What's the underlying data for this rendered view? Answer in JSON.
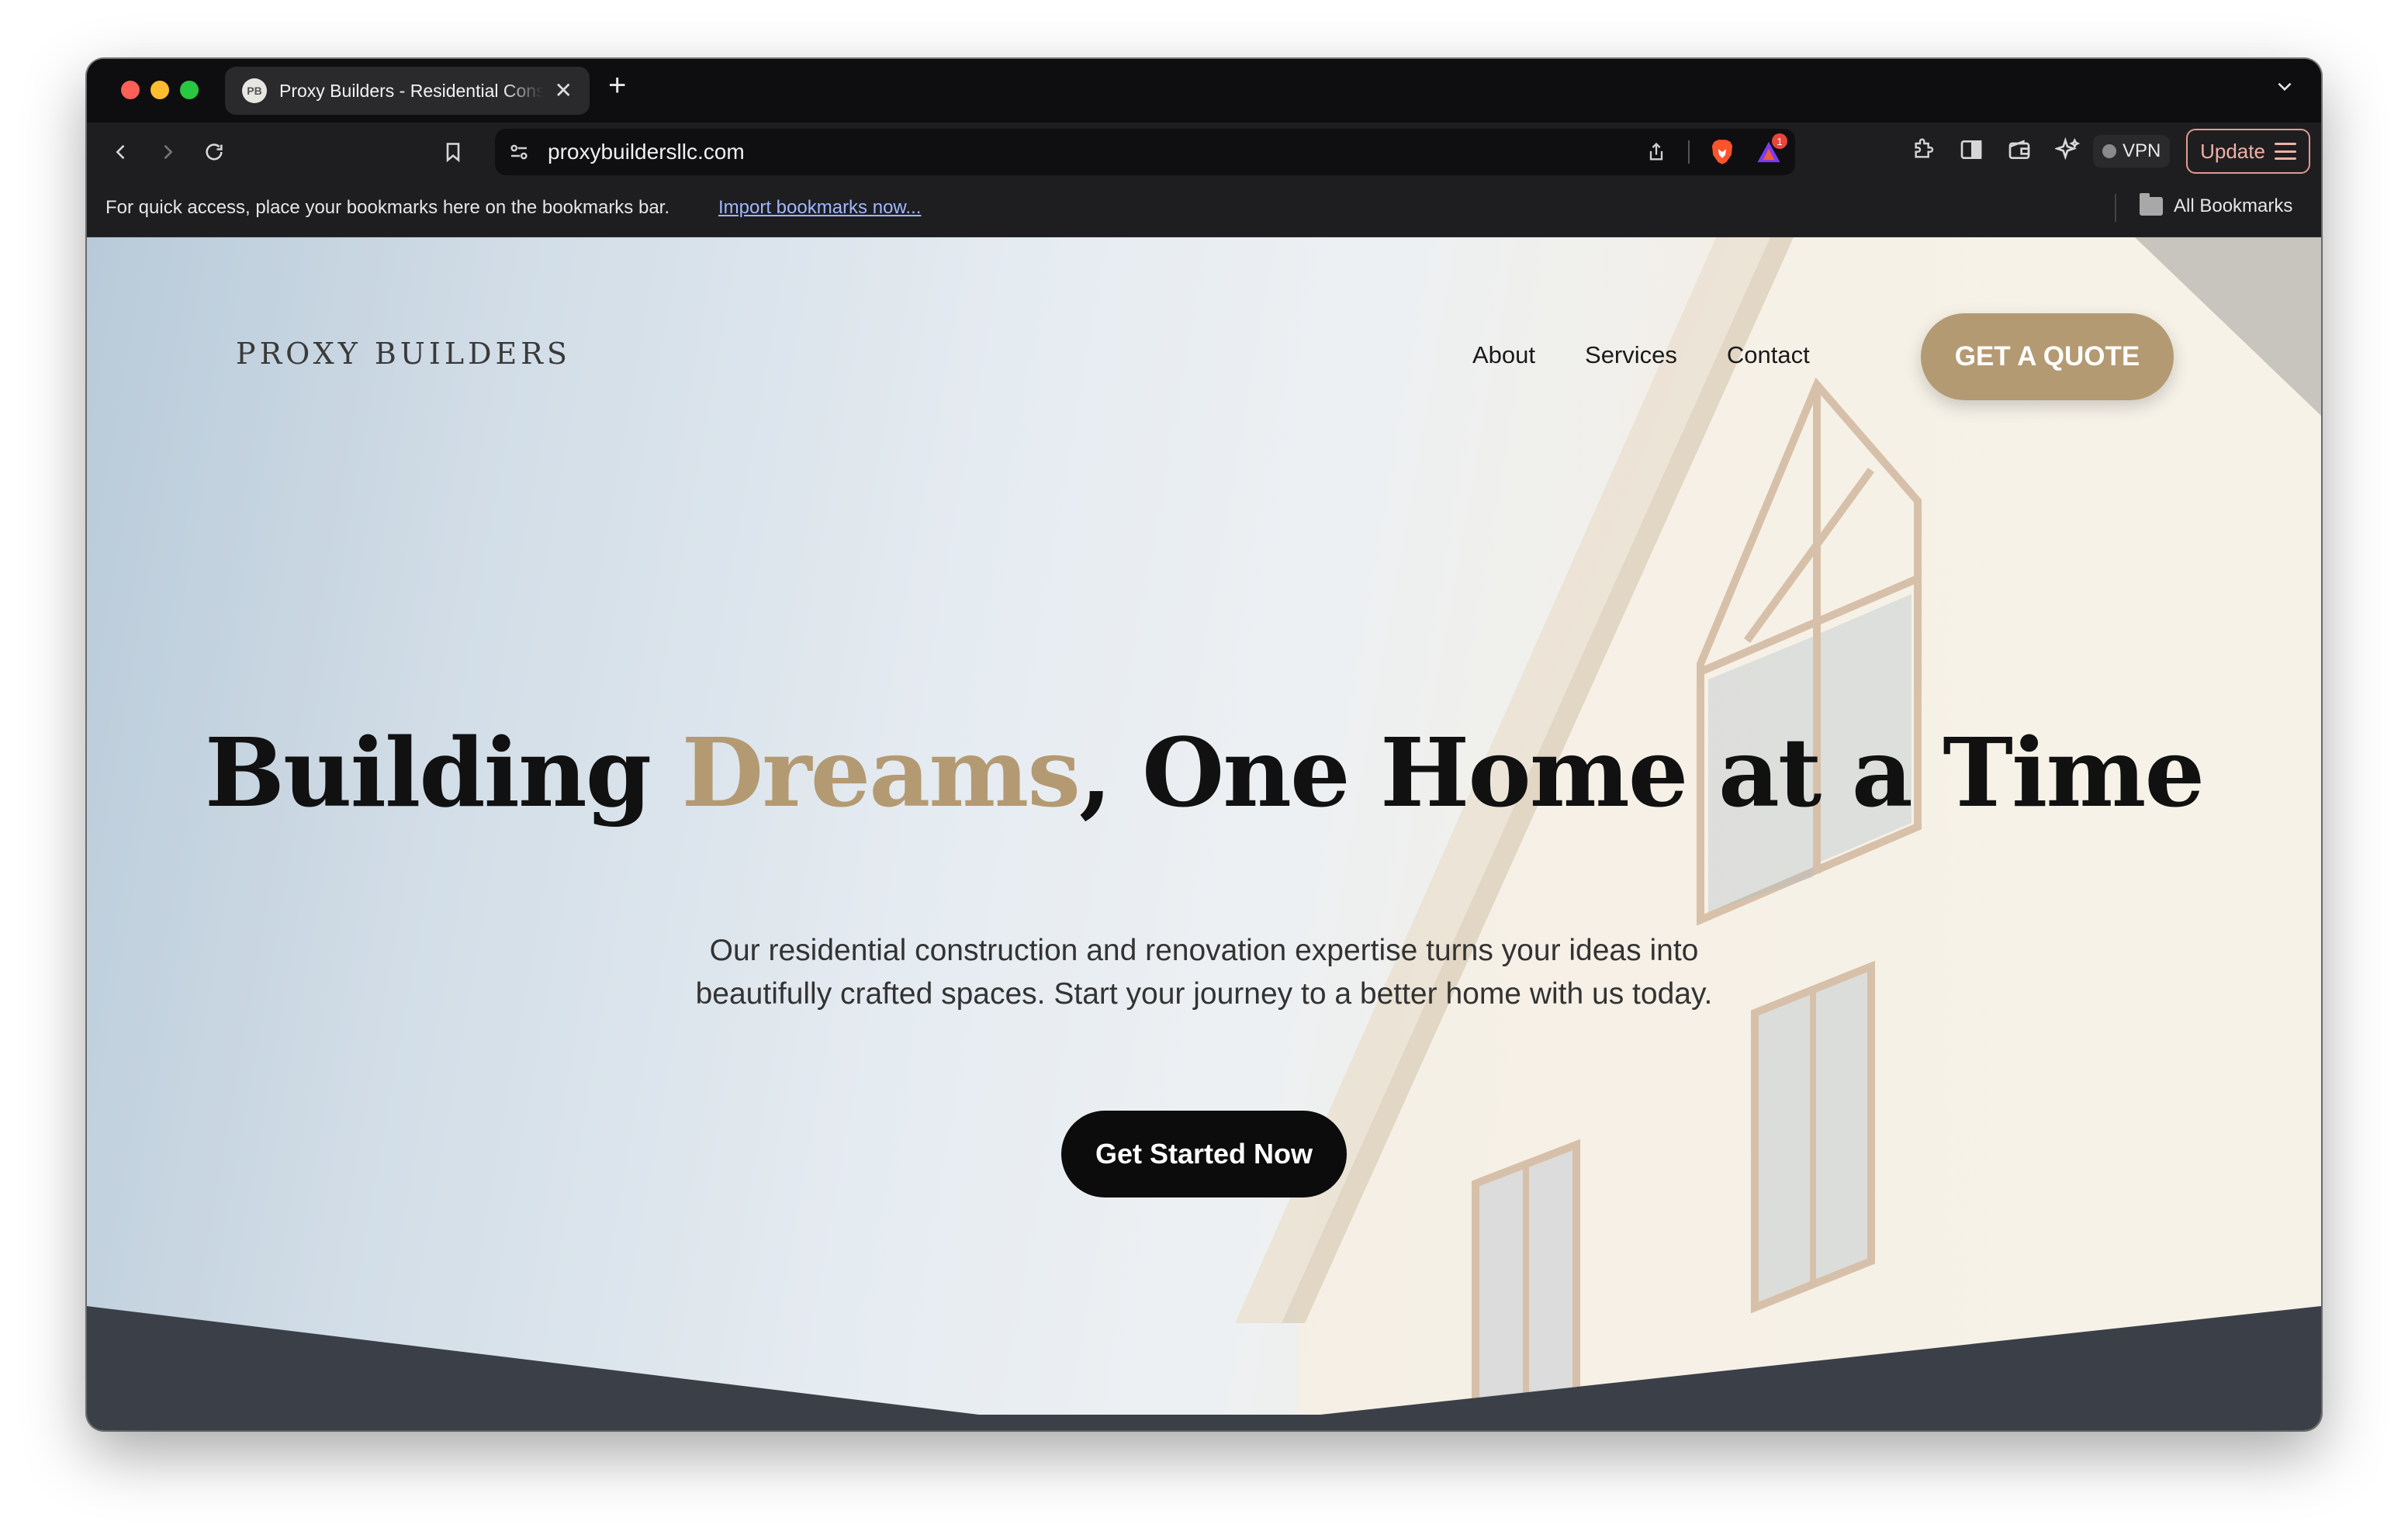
{
  "browser": {
    "tab": {
      "favicon": "PB",
      "title": "Proxy Builders - Residential Construction",
      "close": "✕"
    },
    "new_tab": "+",
    "url": "proxybuildersllc.com",
    "rewards_count": "1",
    "vpn_label": "VPN",
    "update_label": "Update",
    "bookmarks_bar": {
      "message": "For quick access, place your bookmarks here on the bookmarks bar.",
      "import_link": "Import bookmarks now...",
      "all_bookmarks": "All Bookmarks"
    }
  },
  "site": {
    "brand": "PROXY BUILDERS",
    "nav": [
      "About",
      "Services",
      "Contact"
    ],
    "quote_button": "GET A QUOTE",
    "hero": {
      "title_start": "Building ",
      "title_accent": "Dreams",
      "title_end": ", One Home at a Time",
      "subtitle": "Our residential construction and renovation expertise turns your ideas into beautifully crafted spaces. Start your journey to a better home with us today.",
      "cta": "Get Started Now"
    }
  },
  "colors": {
    "accent": "#b49a72",
    "cta_background": "#0c0c0c",
    "footer_band": "#3b4048"
  }
}
